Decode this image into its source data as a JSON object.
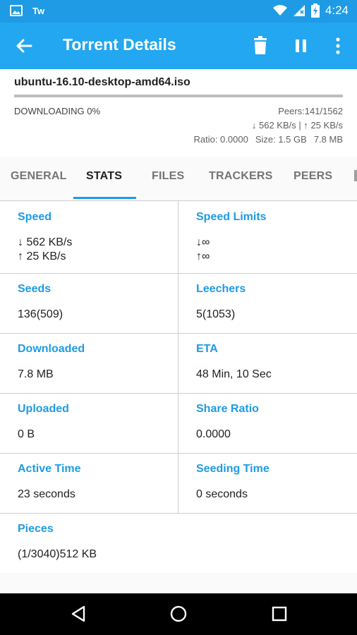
{
  "status_bar": {
    "app_icon": "image-icon",
    "app_text": "Tw",
    "time": "4:24",
    "battery_level": "4"
  },
  "appbar": {
    "title": "Torrent Details",
    "back_icon": "arrow-left-icon",
    "actions": [
      "delete-icon",
      "pause-icon",
      "more-vert-icon"
    ]
  },
  "torrent": {
    "name": "ubuntu-16.10-desktop-amd64.iso",
    "status": "DOWNLOADING 0%",
    "progress": 0,
    "peers": "Peers:141/1562",
    "rates": "↓ 562 KB/s | ↑ 25 KB/s",
    "ratio": "Ratio: 0.0000",
    "size": "Size: 1.5 GB",
    "downloaded": "7.8 MB"
  },
  "tabs": [
    {
      "label": "GENERAL",
      "active": false
    },
    {
      "label": "STATS",
      "active": true
    },
    {
      "label": "FILES",
      "active": false
    },
    {
      "label": "TRACKERS",
      "active": false
    },
    {
      "label": "PEERS",
      "active": false
    }
  ],
  "stats": {
    "speed_label": "Speed",
    "speed_down": "↓ 562 KB/s",
    "speed_up": "↑ 25 KB/s",
    "limits_label": "Speed Limits",
    "limit_down": "↓∞",
    "limit_up": "↑∞",
    "seeds_label": "Seeds",
    "seeds_value": "136(509)",
    "leechers_label": "Leechers",
    "leechers_value": "5(1053)",
    "downloaded_label": "Downloaded",
    "downloaded_value": "7.8 MB",
    "eta_label": "ETA",
    "eta_value": "48 Min, 10 Sec",
    "uploaded_label": "Uploaded",
    "uploaded_value": "0 B",
    "share_label": "Share Ratio",
    "share_value": "0.0000",
    "active_label": "Active Time",
    "active_value": "23 seconds",
    "seeding_label": "Seeding Time",
    "seeding_value": "0 seconds",
    "pieces_label": "Pieces",
    "pieces_value": "(1/3040)512 KB"
  },
  "navbar": {
    "icons": [
      "back-triangle-icon",
      "home-circle-icon",
      "recents-square-icon"
    ]
  },
  "colors": {
    "accent": "#1e9be4",
    "appbar": "#22a7f0",
    "statusbar": "#1e9be4"
  }
}
